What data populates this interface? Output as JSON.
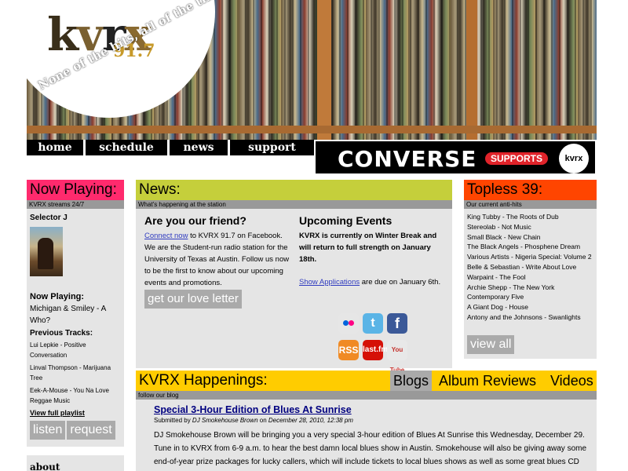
{
  "header": {
    "logo_letters": [
      "k",
      "v",
      "r",
      "x"
    ],
    "logo_freq": "91.7",
    "tagline": "None of the hits, all of the time."
  },
  "nav": {
    "home": "home",
    "schedule": "schedule",
    "news": "news",
    "support": "support"
  },
  "banner": {
    "brand": "CONVERSE",
    "supports": "SUPPORTS",
    "logo": "kvrx 91.7"
  },
  "now_playing": {
    "title": "Now Playing:",
    "subtitle": "KVRX streams 24/7",
    "selector": "Selector J",
    "current_label": "Now Playing:",
    "current_track": "Michigan & Smiley - A Who?",
    "previous_label": "Previous Tracks:",
    "previous": [
      "Lui Lepkie - Positive Conversation",
      "Linval Thompson - Marijuana Tree",
      "Eek-A-Mouse - You Na Love Reggae Music"
    ],
    "full_playlist": "View full playlist",
    "listen": "listen",
    "request": "request"
  },
  "about": {
    "title": "about"
  },
  "news": {
    "title": "News:",
    "subtitle": "What's happening at the station",
    "friend_heading": "Are you our friend?",
    "friend_link": "Connect now",
    "friend_text": " to KVRX 91.7 on Facebook. We are the Student-run radio station for the University of Texas at Austin. Follow us now to be the first to know about our upcoming events and promotions.",
    "love_letter": "get our love letter",
    "events_heading": "Upcoming Events",
    "events_bold": "KVRX is currently on Winter Break and will return to full strength on January 18th.",
    "apps_link": "Show Applications",
    "apps_text": " are due on January 6th.",
    "social": {
      "flickr": "flickr-icon",
      "twitter": "t",
      "facebook": "f",
      "rss": "RSS",
      "lastfm": "last.fm",
      "youtube": "You Tube"
    }
  },
  "topless": {
    "title": "Topless 39:",
    "subtitle": "Our current anti-hits",
    "items": [
      "King Tubby - The Roots of Dub",
      "Stereolab - Not Music",
      "Small Black - New Chain",
      "The Black Angels - Phosphene Dream",
      "Various Artists - Nigeria Special: Volume 2",
      "Belle & Sebastian - Write About Love",
      "Warpaint - The Fool",
      "Archie Shepp - The New York Contemporary Five",
      "A Giant Dog - House",
      "Antony and the Johnsons - Swanlights"
    ],
    "view_all": "view all"
  },
  "happenings": {
    "title": "KVRX Happenings:",
    "subtitle": "follow our blog",
    "tabs": {
      "blogs": "Blogs",
      "reviews": "Album Reviews",
      "videos": "Videos"
    },
    "post_title": "Special 3-Hour Edition of Blues At Sunrise",
    "post_meta_prefix": "Submitted by ",
    "post_author": "DJ Smokehouse Brown",
    "post_meta_mid": " on ",
    "post_date": "December 28, 2010, 12:38 pm",
    "post_text": "DJ Smokehouse Brown will be bringing you a very special 3-hour edition of Blues At Sunrise this Wednesday, December 29. Tune in to KVRX from 6-9 a.m. to hear the best damn local blues show in Austin. Smokehouse will also be giving away some end-of-year prize packages for lucky callers, which will include tickets to local blues shows as well as some great blues CD compilations from Telarc Records."
  },
  "colors": {
    "now_playing": "#ff2a6d",
    "news": "#c5cf3b",
    "topless": "#ff4500",
    "happenings": "#ffcc00",
    "panel_bg": "#e5e5e5",
    "link": "#2e3abf"
  }
}
